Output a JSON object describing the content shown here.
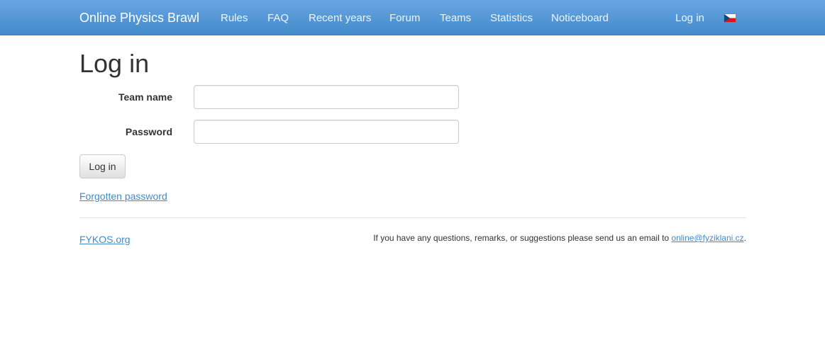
{
  "navbar": {
    "brand": "Online Physics Brawl",
    "items": [
      {
        "label": "Rules"
      },
      {
        "label": "FAQ"
      },
      {
        "label": "Recent years"
      },
      {
        "label": "Forum"
      },
      {
        "label": "Teams"
      },
      {
        "label": "Statistics"
      },
      {
        "label": "Noticeboard"
      }
    ],
    "login_label": "Log in",
    "language_flag_icon": "czech-flag-icon"
  },
  "main": {
    "title": "Log in",
    "team_name_label": "Team name",
    "team_name_value": "",
    "password_label": "Password",
    "password_value": "",
    "submit_label": "Log in",
    "forgotten_password_label": "Forgotten password"
  },
  "footer": {
    "site_link": "FYKOS.org",
    "note_text": "If you have any questions, remarks, or suggestions please send us an email to ",
    "email": "online@fyziklani.cz",
    "note_suffix": "."
  },
  "colors": {
    "navbar_top": "#6aa5e3",
    "navbar_bottom": "#428bca",
    "link": "#428bca"
  }
}
